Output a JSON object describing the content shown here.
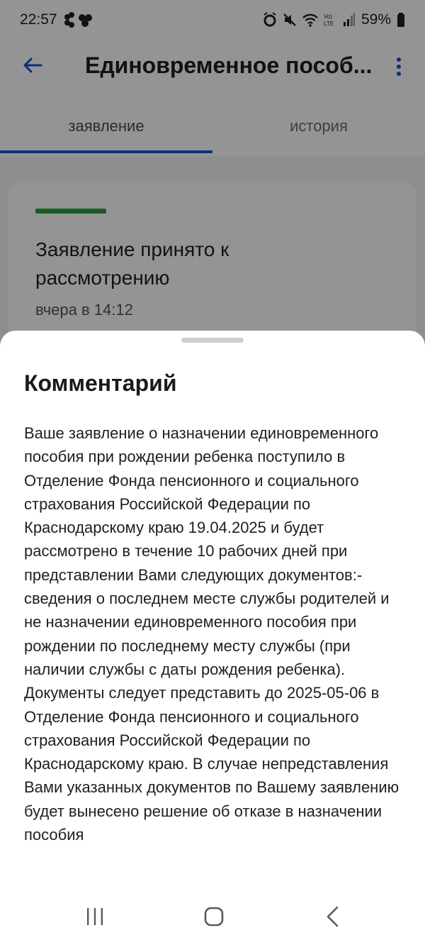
{
  "status_bar": {
    "time": "22:57",
    "battery": "59%",
    "icons": [
      "notification-dots-icon",
      "alarm-icon",
      "mute-icon",
      "wifi-icon",
      "volte-icon",
      "signal-icon",
      "battery-icon"
    ],
    "network_label": "Vo) LTE"
  },
  "app_bar": {
    "title": "Единовременное пособ...",
    "back_icon": "arrow-back-icon",
    "menu_icon": "more-vert-icon"
  },
  "tabs": [
    {
      "label": "заявление",
      "active": true
    },
    {
      "label": "история",
      "active": false
    }
  ],
  "status_card": {
    "title": "Заявление принято к рассмотрению",
    "time": "вчера в 14:12",
    "status_color": "#2e9d3d"
  },
  "sheet": {
    "title": "Комментарий",
    "text": "Ваше заявление о назначении единовременного пособия при рождении ребенка поступило в Отделение Фонда пенсионного и социального страхования Российской Федерации по Краснодарскому краю 19.04.2025 и будет рассмотрено в течение 10 рабочих дней при представлении Вами следующих документов:- сведения о последнем месте службы родителей и не назначении единовременного пособия при рождении по последнему месту службы (при наличии службы с даты рождения ребенка). Документы следует представить до 2025-05-06 в Отделение Фонда пенсионного и социального страхования Российской Федерации по Краснодарскому краю. В случае непредставления Вами указанных документов по Вашему заявлению будет вынесено решение об отказе в назначении пособия"
  },
  "nav_bar": {
    "buttons": [
      "recent-apps-icon",
      "home-icon",
      "back-icon"
    ]
  },
  "colors": {
    "accent": "#1e4fd4",
    "status_green": "#2e9d3d",
    "scrim": "rgba(0,0,0,0.42)"
  }
}
